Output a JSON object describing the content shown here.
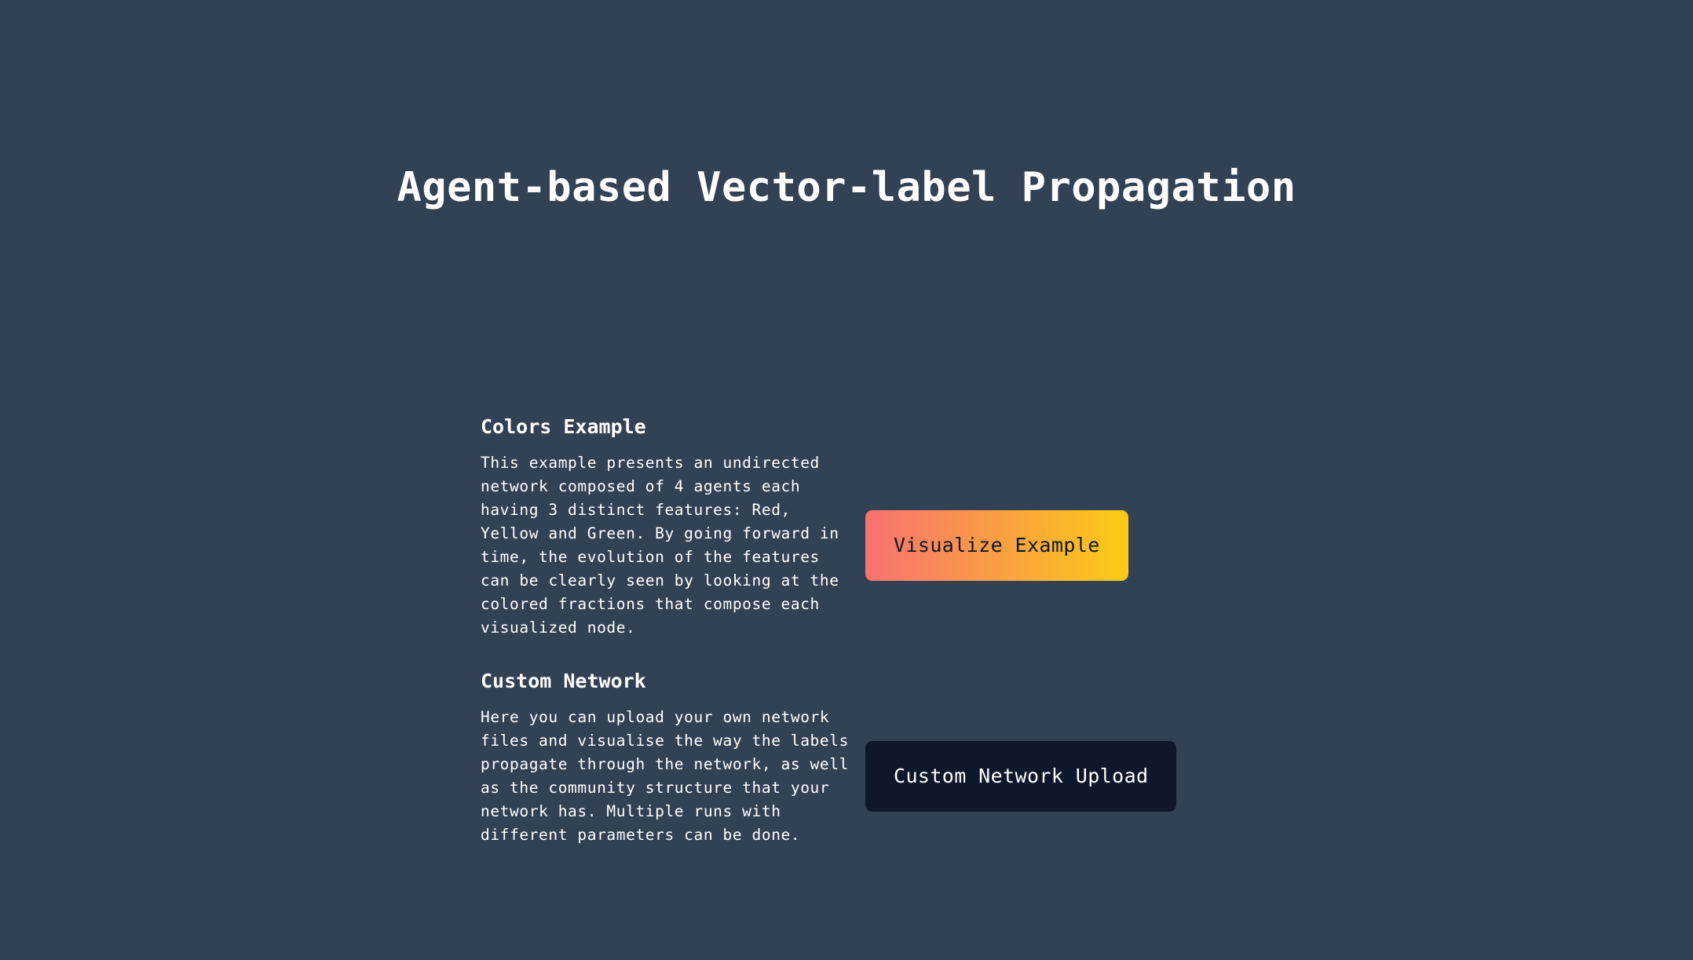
{
  "page": {
    "title": "Agent-based Vector-label Propagation"
  },
  "colors": {
    "background": "#334155",
    "text": "#ffffff",
    "gradient_start": "#f87171",
    "gradient_end": "#facc15",
    "dark_button": "#0f172a"
  },
  "sections": [
    {
      "heading": "Colors Example",
      "description": "This example presents an undirected network composed of 4 agents each having 3 distinct features: Red, Yellow and Green. By going forward in time, the evolution of the features can be clearly seen by looking at the colored fractions that compose each visualized node.",
      "button_label": "Visualize Example"
    },
    {
      "heading": "Custom Network",
      "description": "Here you can upload your own network files and visualise the way the labels propagate through the network, as well as the community structure that your network has. Multiple runs with different parameters can be done.",
      "button_label": "Custom Network Upload"
    }
  ]
}
